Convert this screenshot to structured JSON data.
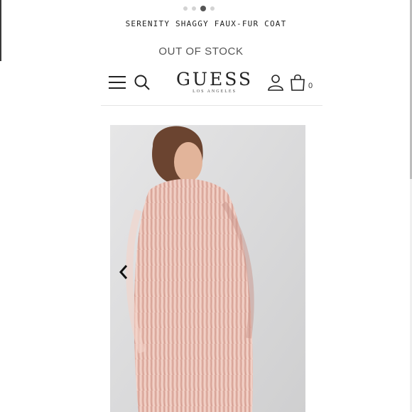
{
  "carousel": {
    "page_count": 4,
    "active_index": 2
  },
  "product": {
    "title": "SERENITY SHAGGY FAUX-FUR COAT",
    "stock_status": "OUT OF STOCK"
  },
  "header": {
    "logo_main": "GUESS",
    "logo_sub": "LOS ANGELES",
    "bag_count": "0",
    "icons": [
      "menu-icon",
      "search-icon",
      "user-icon",
      "bag-icon"
    ]
  },
  "image": {
    "description_icon": "chevron-left-icon"
  },
  "colors": {
    "coat": "#e7b9ae",
    "background": "#d9d9da",
    "text": "#222222"
  }
}
